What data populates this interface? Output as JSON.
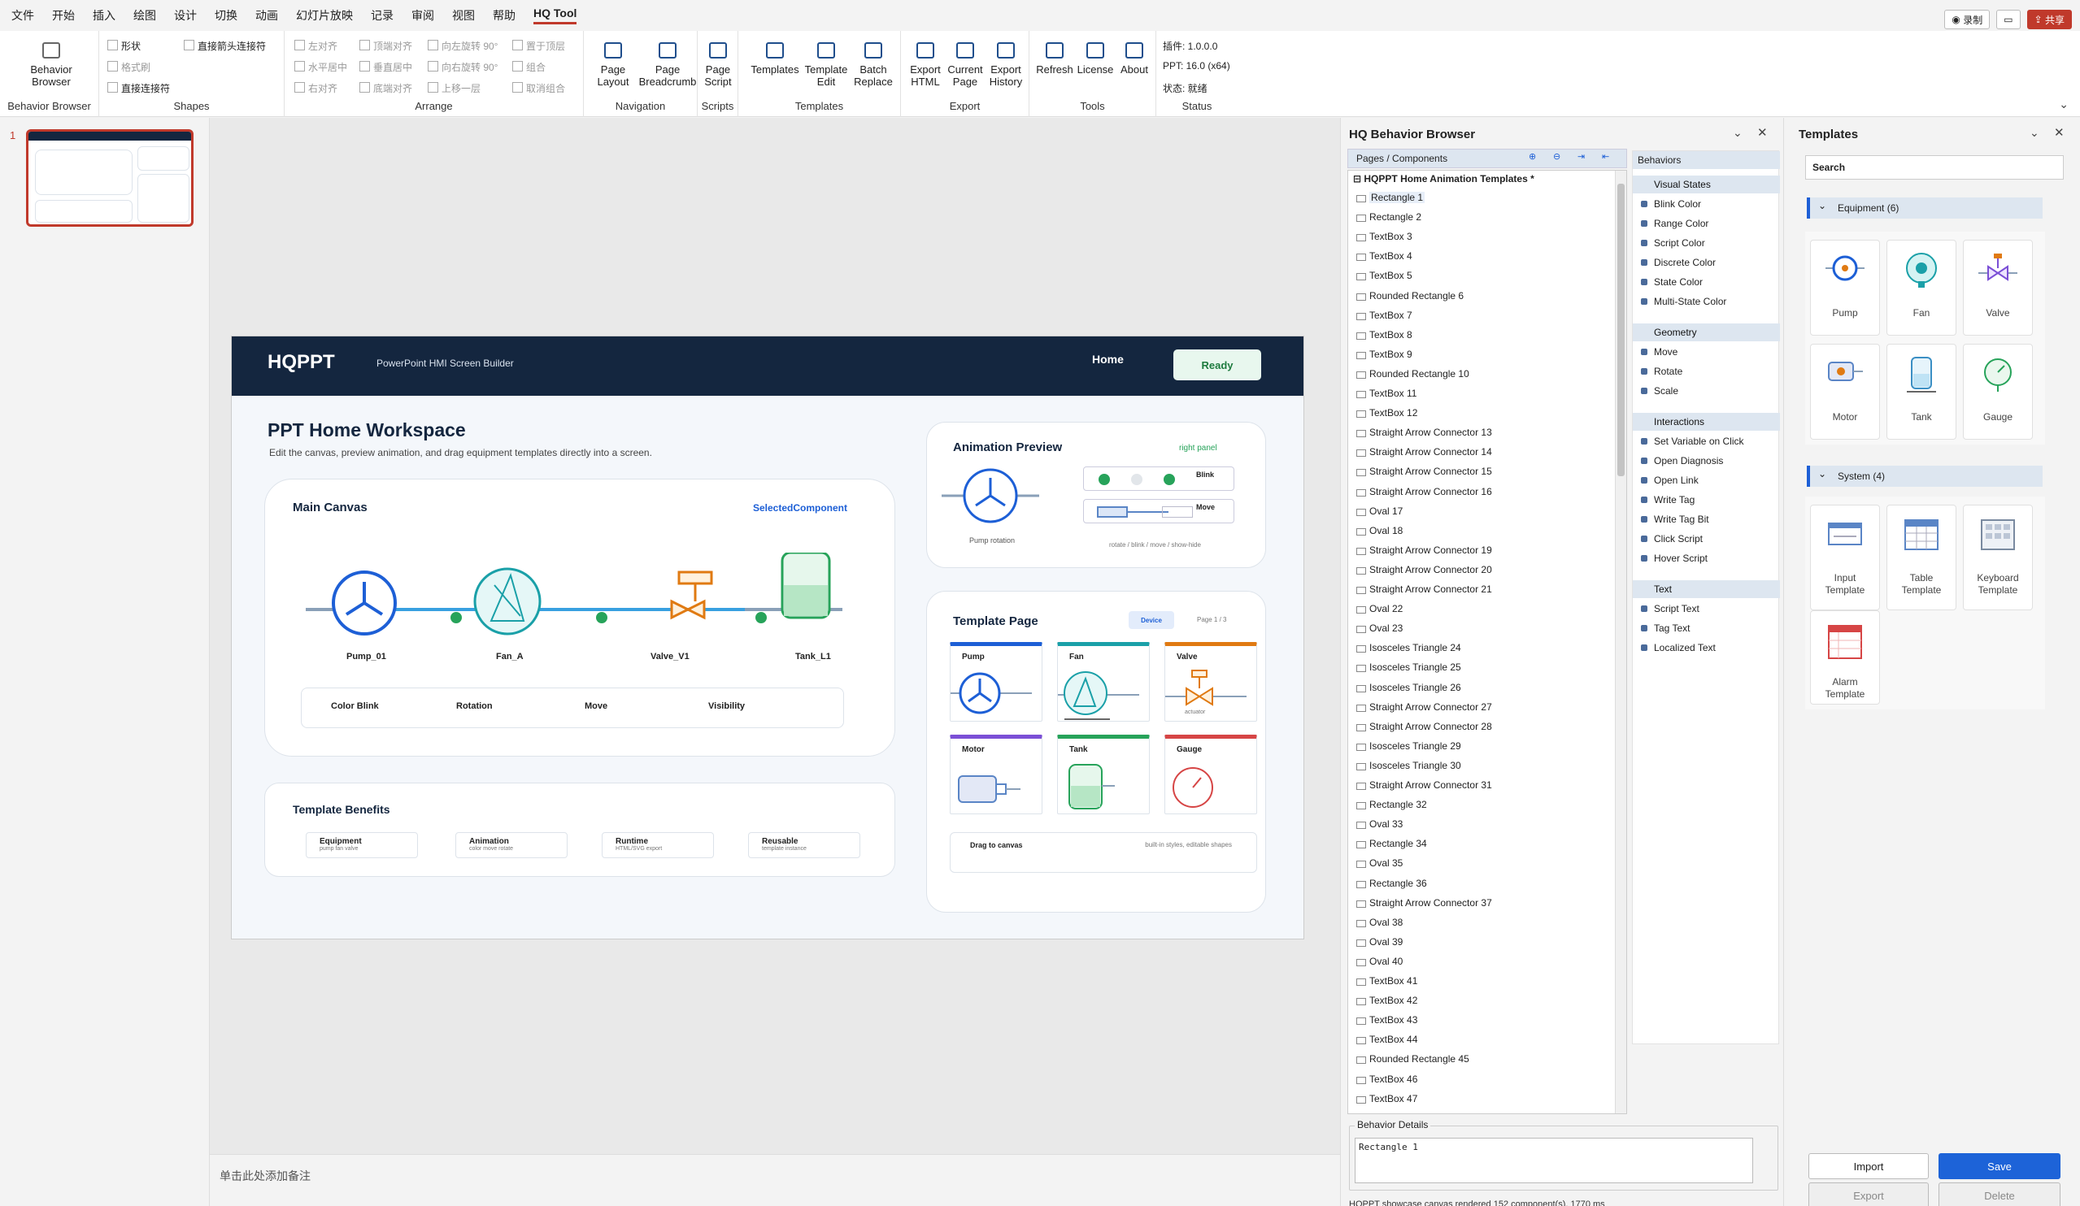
{
  "menu": [
    "文件",
    "开始",
    "插入",
    "绘图",
    "设计",
    "切换",
    "动画",
    "幻灯片放映",
    "记录",
    "审阅",
    "视图",
    "帮助",
    "HQ Tool"
  ],
  "window_buttons": {
    "record": "录制",
    "share": "共享"
  },
  "ribbon": {
    "behavior_browser": {
      "button": "Behavior\nBrowser",
      "group": "Behavior Browser"
    },
    "shapes": {
      "shape": "形状",
      "format_painter": "格式刷",
      "arrow_connector": "直接箭头连接符",
      "connector": "直接连接符",
      "group": "Shapes"
    },
    "arrange": {
      "items": [
        "左对齐",
        "顶端对齐",
        "向左旋转 90°",
        "置于顶层",
        "水平居中",
        "垂直居中",
        "向右旋转 90°",
        "组合",
        "右对齐",
        "底端对齐",
        "上移一层",
        "取消组合"
      ],
      "group": "Arrange"
    },
    "navigation": {
      "items": [
        "Page\nLayout",
        "Page\nBreadcrumb"
      ],
      "group": "Navigation"
    },
    "scripts": {
      "items": [
        "Page\nScript"
      ],
      "group": "Scripts"
    },
    "templates": {
      "items": [
        "Templates",
        "Template\nEdit",
        "Batch\nReplace"
      ],
      "group": "Templates"
    },
    "export": {
      "items": [
        "Export\nHTML",
        "Current\nPage",
        "Export\nHistory"
      ],
      "group": "Export"
    },
    "tools": {
      "items": [
        "Refresh",
        "License",
        "About"
      ],
      "group": "Tools"
    },
    "status": {
      "plugin": "插件: 1.0.0.0",
      "ppt": "PPT: 16.0 (x64)",
      "state": "状态: 就绪",
      "group": "Status"
    }
  },
  "thumb_number": "1",
  "notes_placeholder": "单击此处添加备注",
  "slide": {
    "brand": "HQPPT",
    "tagline": "PowerPoint HMI Screen Builder",
    "nav_home": "Home",
    "ready": "Ready",
    "title": "PPT Home Workspace",
    "subtitle": "Edit the canvas, preview animation, and drag equipment templates directly into a screen.",
    "main_canvas": "Main Canvas",
    "selected": "SelectedComponent",
    "equipment": [
      "Pump_01",
      "Fan_A",
      "Valve_V1",
      "Tank_L1"
    ],
    "legend": [
      "Color Blink",
      "Rotation",
      "Move",
      "Visibility"
    ],
    "benefits_title": "Template Benefits",
    "benefits": [
      {
        "t": "Equipment",
        "s": "pump fan valve"
      },
      {
        "t": "Animation",
        "s": "color move rotate"
      },
      {
        "t": "Runtime",
        "s": "HTML/SVG export"
      },
      {
        "t": "Reusable",
        "s": "template instance"
      }
    ],
    "preview_title": "Animation Preview",
    "preview_tag": "right panel",
    "pump_rotation": "Pump rotation",
    "blink": "Blink",
    "move": "Move",
    "preview_note": "rotate / blink / move / show-hide",
    "template_page": "Template Page",
    "device": "Device",
    "page_count": "Page 1 / 3",
    "tiles": [
      {
        "t": "Pump",
        "c": "#1d5fd6"
      },
      {
        "t": "Fan",
        "c": "#1aa0a8"
      },
      {
        "t": "Valve",
        "c": "#e07a12"
      },
      {
        "t": "Motor",
        "c": "#7b4fd6"
      },
      {
        "t": "Tank",
        "c": "#27a35a"
      },
      {
        "t": "Gauge",
        "c": "#d64545"
      }
    ],
    "actuator": "actuator",
    "drag": "Drag to canvas",
    "drag_note": "built-in styles, editable shapes"
  },
  "behavior_browser": {
    "title": "HQ Behavior Browser",
    "pages_header": "Pages / Components",
    "behaviors_header": "Behaviors",
    "root": "HQPPT Home Animation Templates *",
    "components": [
      "Rectangle 1",
      "Rectangle 2",
      "TextBox 3",
      "TextBox 4",
      "TextBox 5",
      "Rounded Rectangle 6",
      "TextBox 7",
      "TextBox 8",
      "TextBox 9",
      "Rounded Rectangle 10",
      "TextBox 11",
      "TextBox 12",
      "Straight Arrow Connector 13",
      "Straight Arrow Connector 14",
      "Straight Arrow Connector 15",
      "Straight Arrow Connector 16",
      "Oval 17",
      "Oval 18",
      "Straight Arrow Connector 19",
      "Straight Arrow Connector 20",
      "Straight Arrow Connector 21",
      "Oval 22",
      "Oval 23",
      "Isosceles Triangle 24",
      "Isosceles Triangle 25",
      "Isosceles Triangle 26",
      "Straight Arrow Connector 27",
      "Straight Arrow Connector 28",
      "Isosceles Triangle 29",
      "Isosceles Triangle 30",
      "Straight Arrow Connector 31",
      "Rectangle 32",
      "Oval 33",
      "Rectangle 34",
      "Oval 35",
      "Rectangle 36",
      "Straight Arrow Connector 37",
      "Oval 38",
      "Oval 39",
      "Oval 40",
      "TextBox 41",
      "TextBox 42",
      "TextBox 43",
      "TextBox 44",
      "Rounded Rectangle 45",
      "TextBox 46",
      "TextBox 47"
    ],
    "sections": [
      {
        "name": "Visual States",
        "items": [
          "Blink Color",
          "Range Color",
          "Script Color",
          "Discrete Color",
          "State Color",
          "Multi-State Color"
        ]
      },
      {
        "name": "Geometry",
        "items": [
          "Move",
          "Rotate",
          "Scale"
        ]
      },
      {
        "name": "Interactions",
        "items": [
          "Set Variable on Click",
          "Open Diagnosis",
          "Open Link",
          "Write Tag",
          "Write Tag Bit",
          "Click Script",
          "Hover Script"
        ]
      },
      {
        "name": "Text",
        "items": [
          "Script Text",
          "Tag Text",
          "Localized Text"
        ]
      }
    ],
    "details_label": "Behavior Details",
    "details_value": "Rectangle 1",
    "footer": "HQPPT showcase canvas rendered 152 component(s), 1770 ms"
  },
  "templates": {
    "title": "Templates",
    "search_placeholder": "Search",
    "equipment_header": "Equipment (6)",
    "equipment": [
      "Pump",
      "Fan",
      "Valve",
      "Motor",
      "Tank",
      "Gauge"
    ],
    "system_header": "System (4)",
    "system": [
      "Input\nTemplate",
      "Table\nTemplate",
      "Keyboard\nTemplate",
      "Alarm\nTemplate"
    ],
    "import": "Import",
    "save": "Save",
    "export": "Export",
    "delete": "Delete"
  },
  "colors": {
    "accent": "#c0392b",
    "navy": "#14263f",
    "blue": "#1d5fd6",
    "teal": "#1aa0a8",
    "orange": "#e07a12",
    "green": "#27a35a"
  }
}
